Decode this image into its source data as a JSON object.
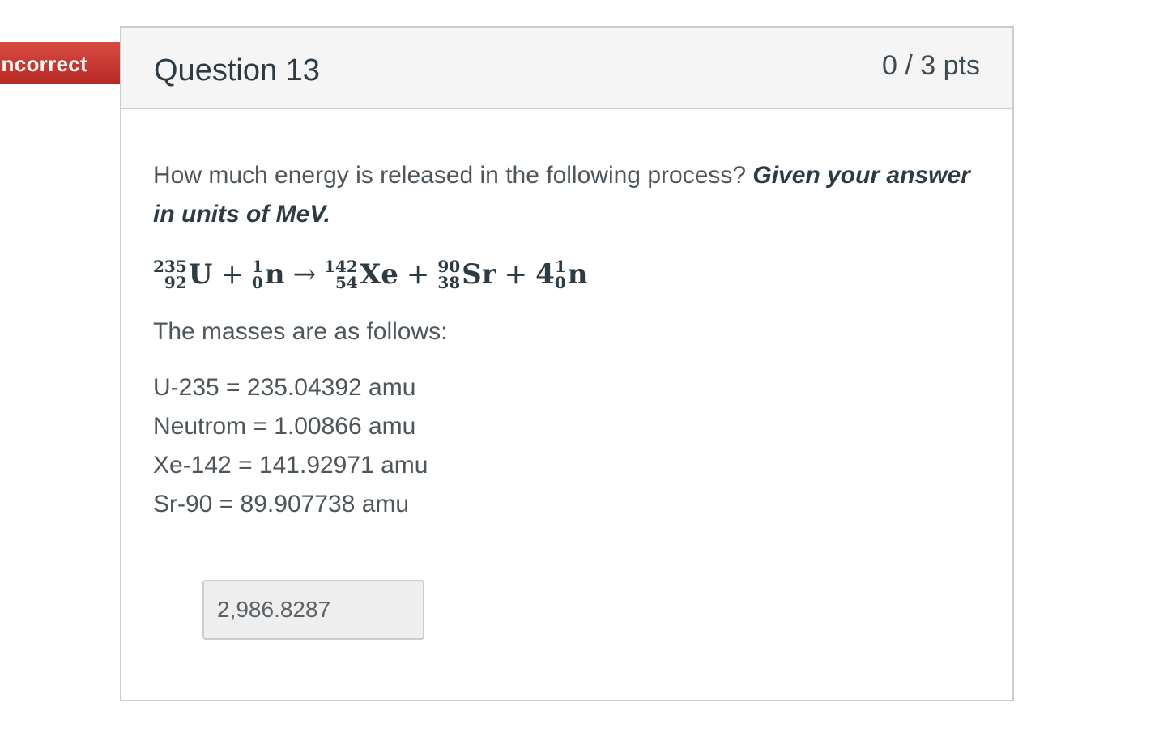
{
  "status": {
    "label": "Incorrect",
    "color": "#c6342d"
  },
  "question": {
    "title": "Question 13",
    "points": "0 / 3 pts",
    "prompt_text": "How much energy is released in the following process? ",
    "prompt_emphasis": "Given your answer in units of MeV."
  },
  "equation": {
    "terms": [
      {
        "mass": "235",
        "atomic": "92",
        "symbol": "U"
      },
      {
        "mass": "1",
        "atomic": "0",
        "symbol": "n"
      },
      {
        "mass": "142",
        "atomic": "54",
        "symbol": "Xe"
      },
      {
        "mass": "90",
        "atomic": "38",
        "symbol": "Sr"
      },
      {
        "coefficient": "4",
        "mass": "1",
        "atomic": "0",
        "symbol": "n"
      }
    ],
    "plus": "+",
    "arrow": "→"
  },
  "masses": {
    "intro": "The masses are as follows:",
    "items": [
      "U-235 = 235.04392 amu",
      "Neutrom = 1.00866 amu",
      "Xe-142 = 141.92971 amu",
      "Sr-90 = 89.907738 amu"
    ]
  },
  "answer": {
    "value": "2,986.8287"
  }
}
